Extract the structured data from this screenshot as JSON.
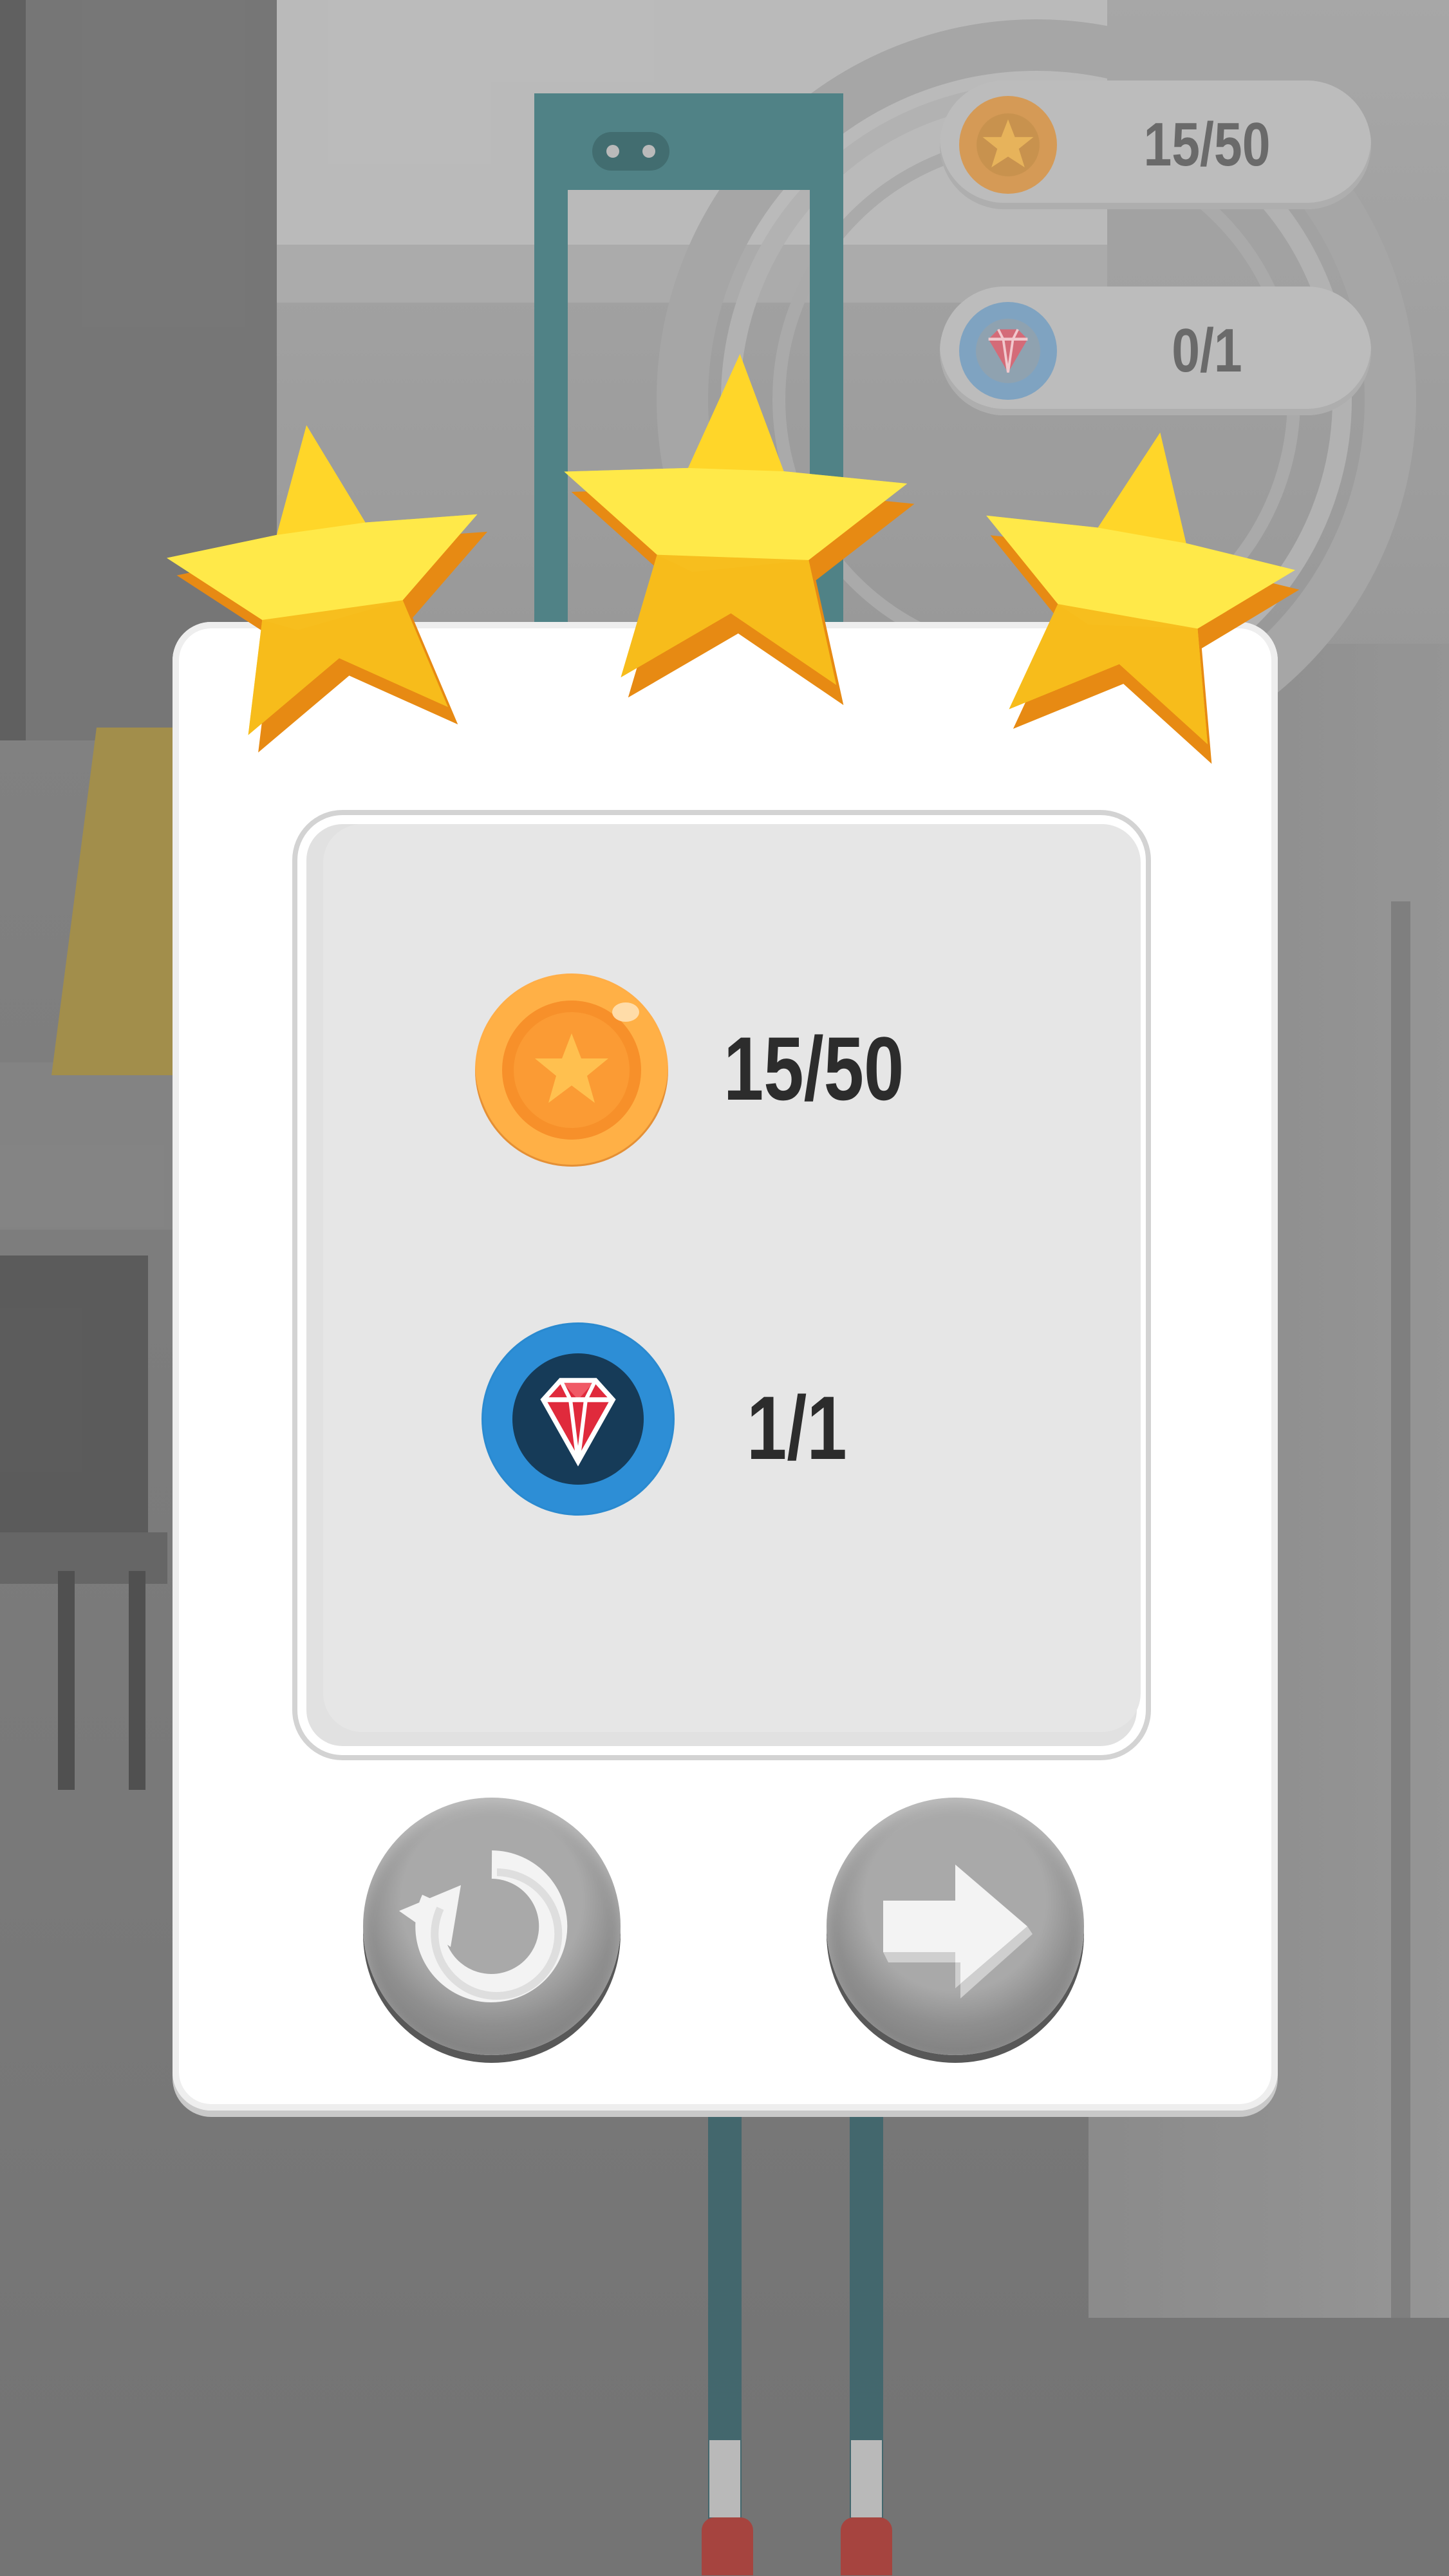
{
  "hud": {
    "coins": {
      "icon": "coin-star-icon",
      "value": "15/50"
    },
    "gems": {
      "icon": "gem-icon",
      "value": "0/1"
    }
  },
  "rating": {
    "stars_earned": 3,
    "stars_total": 3
  },
  "results": {
    "coins": {
      "icon": "coin-star-icon",
      "value": "15/50"
    },
    "gems": {
      "icon": "gem-icon",
      "value": "1/1"
    }
  },
  "buttons": {
    "replay": {
      "icon": "replay-icon"
    },
    "next": {
      "icon": "arrow-right-icon"
    }
  },
  "colors": {
    "coin": "#fb9e34",
    "gem_ring": "#2a8ad0",
    "gem": "#d9263a",
    "star": "#ffd829",
    "star_edge": "#e98b12",
    "panel": "#e6e6e6",
    "text": "#2c2c2c"
  }
}
